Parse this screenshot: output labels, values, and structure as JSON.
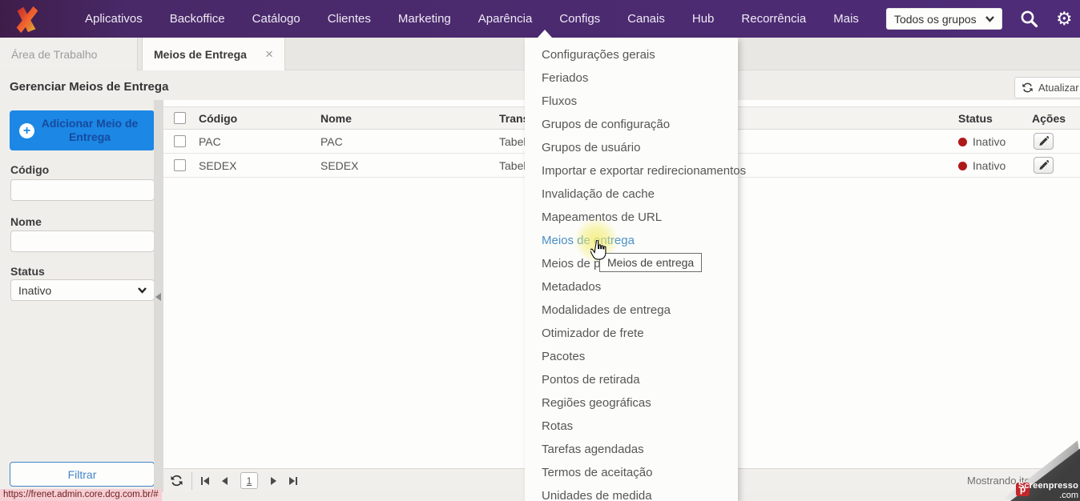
{
  "nav": {
    "logo": "frenet-admin-logo",
    "items": [
      "Aplicativos",
      "Backoffice",
      "Catálogo",
      "Clientes",
      "Marketing",
      "Aparência",
      "Configs",
      "Canais",
      "Hub",
      "Recorrência",
      "Mais"
    ],
    "active_item": "Configs",
    "group_select_value": "Todos os grupos",
    "bg_color": "#4e2c78"
  },
  "tabs": [
    {
      "label": "Área de Trabalho",
      "active": false,
      "closable": false
    },
    {
      "label": "Meios de Entrega",
      "active": true,
      "closable": true
    }
  ],
  "page": {
    "title": "Gerenciar Meios de Entrega",
    "refresh_label": "Atualizar"
  },
  "sidebar": {
    "add_button": "Adicionar Meio de Entrega",
    "fields": [
      {
        "label": "Código",
        "value": ""
      },
      {
        "label": "Nome",
        "value": ""
      }
    ],
    "status_label": "Status",
    "status_value": "Inativo",
    "filter_button": "Filtrar"
  },
  "table": {
    "columns": [
      "",
      "Código",
      "Nome",
      "Trans",
      "Status",
      "Ações"
    ],
    "rows": [
      {
        "codigo": "PAC",
        "nome": "PAC",
        "trans": "Tabel",
        "status": "Inativo"
      },
      {
        "codigo": "SEDEX",
        "nome": "SEDEX",
        "trans": "Tabel",
        "status": "Inativo"
      }
    ],
    "status_dot_color": "#b01818",
    "footer": {
      "page_value": "1",
      "showing_text": "Mostrando ite"
    }
  },
  "menu": {
    "items": [
      "Configurações gerais",
      "Feriados",
      "Fluxos",
      "Grupos de configuração",
      "Grupos de usuário",
      "Importar e exportar redirecionamentos",
      "Invalidação de cache",
      "Mapeamentos de URL",
      "Meios de entrega",
      "Meios de pag",
      "Metadados",
      "Modalidades de entrega",
      "Otimizador de frete",
      "Pacotes",
      "Pontos de retirada",
      "Regiões geográficas",
      "Rotas",
      "Tarefas agendadas",
      "Termos de aceitação",
      "Unidades de medida"
    ],
    "hovered_index": 8,
    "hover_color": "#4a90c8",
    "tooltip": "Meios de entrega"
  },
  "statusbar": {
    "url": "https://frenet.admin.core.dcg.com.br/#"
  },
  "watermark": {
    "brand": "Screenpresso",
    "domain": ".com",
    "badge": "p"
  },
  "icons": {
    "search": "magnifier",
    "settings": "gear",
    "chevron_down": "bold-v-chevron",
    "plus_circle": "white-circle-plus",
    "refresh": "two-curved-arrows",
    "close": "×",
    "pencil": "edit-pencil",
    "pager": [
      "first",
      "prev",
      "next",
      "last"
    ],
    "hand_cursor": "pointing-hand",
    "click_halo": "yellow-glow",
    "collapse_handle": "left-triangle"
  },
  "colors": {
    "nav_purple": "#4e2c78",
    "accent_blue": "#1c87e5",
    "button_text_blue": "#164a9e",
    "link_blue": "#4a90c8",
    "status_red": "#b01818",
    "halo_yellow": "#f3ec6e"
  }
}
